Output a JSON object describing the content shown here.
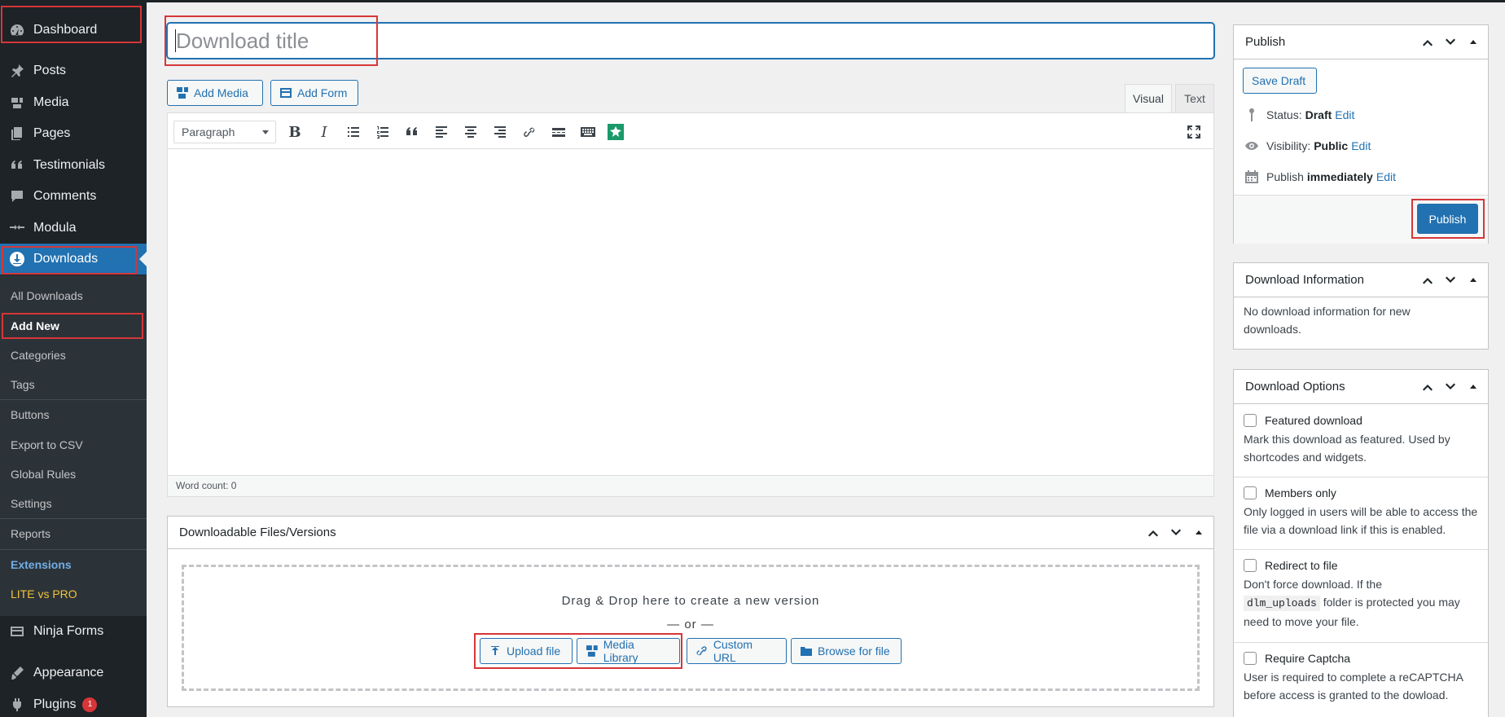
{
  "sidebar": {
    "items": [
      {
        "label": "Dashboard",
        "icon": "dashboard-icon"
      },
      {
        "label": "Posts",
        "icon": "pin-icon"
      },
      {
        "label": "Media",
        "icon": "media-icon"
      },
      {
        "label": "Pages",
        "icon": "pages-icon"
      },
      {
        "label": "Testimonials",
        "icon": "quote-icon"
      },
      {
        "label": "Comments",
        "icon": "comment-icon"
      },
      {
        "label": "Modula",
        "icon": "modula-icon"
      },
      {
        "label": "Downloads",
        "icon": "download-icon"
      }
    ],
    "submenu": [
      "All Downloads",
      "Add New",
      "Categories",
      "Tags",
      "Buttons",
      "Export to CSV",
      "Global Rules",
      "Settings",
      "Reports",
      "Extensions",
      "LITE vs PRO"
    ],
    "bottom_items": [
      {
        "label": "Ninja Forms",
        "icon": "forms-icon"
      },
      {
        "label": "Appearance",
        "icon": "appearance-icon"
      },
      {
        "label": "Plugins",
        "icon": "plugins-icon",
        "badge": "1"
      }
    ]
  },
  "editor": {
    "title_placeholder": "Download title",
    "add_media": "Add Media",
    "add_form": "Add Form",
    "tab_visual": "Visual",
    "tab_text": "Text",
    "format_select": "Paragraph",
    "word_count": "Word count: 0"
  },
  "files_box": {
    "title": "Downloadable Files/Versions",
    "drop_text": "Drag & Drop here to create a new version",
    "or_text": "— or —",
    "buttons": [
      "Upload file",
      "Media Library",
      "Custom URL",
      "Browse for file"
    ]
  },
  "publish": {
    "title": "Publish",
    "save_draft": "Save Draft",
    "status_label": "Status:",
    "status_value": "Draft",
    "visibility_label": "Visibility:",
    "visibility_value": "Public",
    "publish_label": "Publish",
    "publish_value": "immediately",
    "edit": "Edit",
    "publish_button": "Publish"
  },
  "download_info": {
    "title": "Download Information",
    "text": "No download information for new downloads."
  },
  "download_options": {
    "title": "Download Options",
    "options": [
      {
        "label": "Featured download",
        "desc": "Mark this download as featured. Used by shortcodes and widgets."
      },
      {
        "label": "Members only",
        "desc": "Only logged in users will be able to access the file via a download link if this is enabled."
      },
      {
        "label": "Redirect to file",
        "desc_pre": "Don't force download. If the",
        "desc_code": "dlm_uploads",
        "desc_post": "folder is protected you may need to move your file."
      },
      {
        "label": "Require Captcha",
        "desc": "User is required to complete a reCAPTCHA before access is granted to the dowload."
      }
    ]
  },
  "colors": {
    "accent": "#2271b1",
    "sidebar": "#1d2327",
    "highlight": "#d63638"
  }
}
